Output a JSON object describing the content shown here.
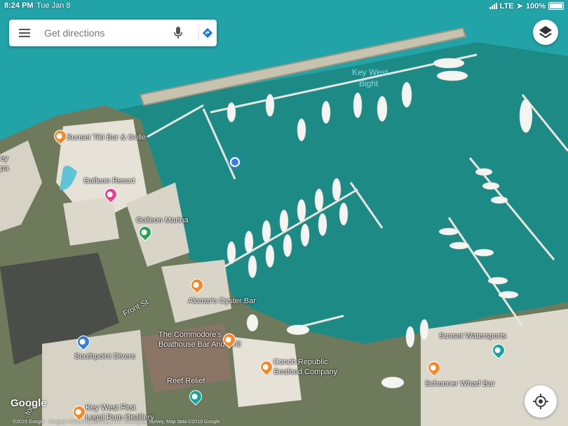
{
  "status": {
    "time": "8:24 PM",
    "date": "Tue Jan 8",
    "network": "LTE",
    "battery": "100%"
  },
  "search": {
    "placeholder": "Get directions"
  },
  "controls": {
    "layers": "layers-icon",
    "locate": "my-location-icon"
  },
  "places": [
    {
      "name": "Sunset Tiki Bar & Grille",
      "category": "restaurant"
    },
    {
      "name": "Galleon Resort",
      "category": "hotel"
    },
    {
      "name": "Galleon Marina",
      "category": "marina"
    },
    {
      "name": "Alonzo's Oyster Bar",
      "category": "restaurant"
    },
    {
      "name": "The Commodore's Boathouse Bar And Grill",
      "category": "restaurant"
    },
    {
      "name": "Southpoint Divers",
      "category": "shop"
    },
    {
      "name": "Conch Republic Seafood Company",
      "category": "restaurant"
    },
    {
      "name": "Reef Relief",
      "category": "attraction"
    },
    {
      "name": "Key West First Legal Rum Distillery",
      "category": "attraction"
    },
    {
      "name": "Sunset Watersports",
      "category": "attraction"
    },
    {
      "name": "Schooner Wharf Bar",
      "category": "restaurant"
    }
  ],
  "labels": {
    "key_west_bight": "Key West Bight",
    "front_st": "Front St",
    "sunset_tiki": "Sunset Tiki Bar & Grille",
    "galleon_resort": "Galleon Resort",
    "galleon_marina": "Galleon Marina",
    "alonzo": "Alonzo's Oyster Bar",
    "commodore_1": "The Commodore's",
    "commodore_2": "Boathouse Bar And Grill",
    "southpoint": "Southpoint Divers",
    "conch_1": "Conch Republic",
    "conch_2": "Seafood Company",
    "reef_relief": "Reef Relief",
    "rum_1": "Key West First",
    "rum_2": "Legal Rum Distillery",
    "sunset_water": "Sunset Watersports",
    "schooner": "Schooner Wharf Bar",
    "edge_left_1": "ey",
    "edge_left_2": "pa",
    "edge_bottom": "...ton"
  },
  "branding": {
    "logo": "Google",
    "copyright": "©2019 Google · Imagery ©2019 DigitalGlobe, U.S. Geological Survey, Map data ©2019 Google"
  },
  "colors": {
    "water": "#1d8a86",
    "deep_water": "#1fa3a0",
    "land": "#6f7a5c",
    "restaurant_pin": "#f08a2c",
    "hotel_pin": "#e8408f",
    "marina_pin": "#2aa05a",
    "shop_pin": "#3b7bd8",
    "attraction_pin": "#14a3a0",
    "location_dot": "#3b7bf2"
  }
}
